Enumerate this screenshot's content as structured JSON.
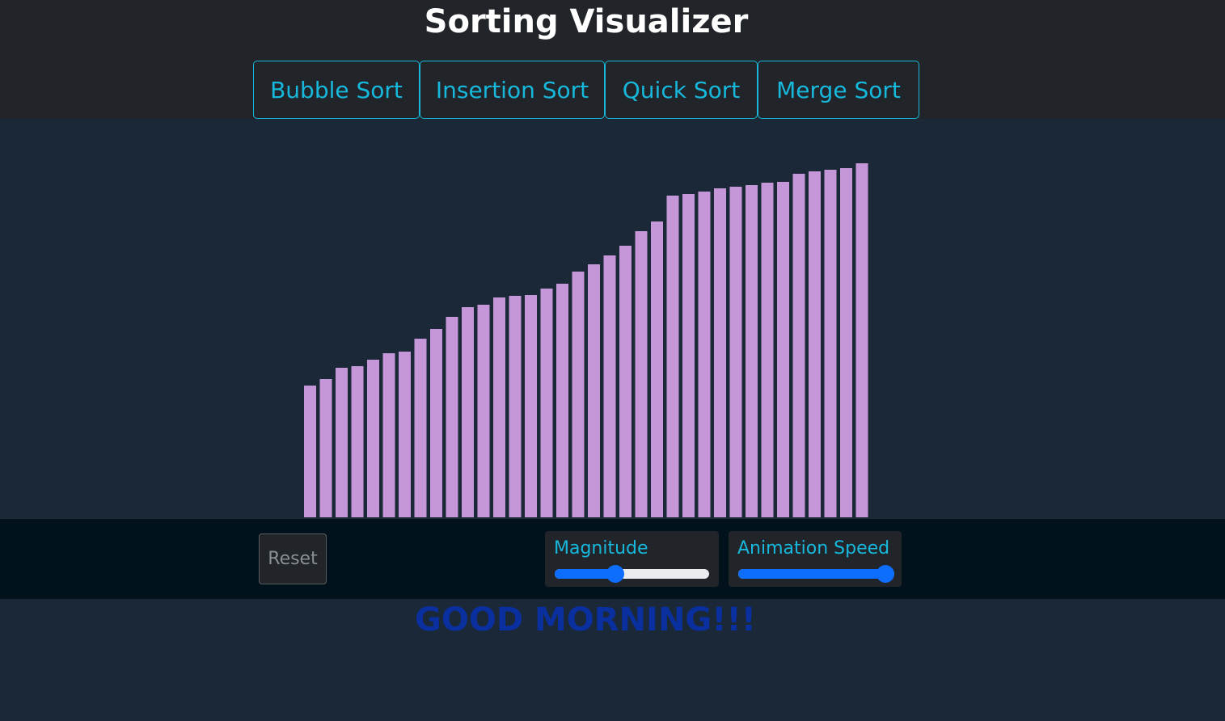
{
  "app": {
    "title": "Sorting Visualizer"
  },
  "algorithms": [
    {
      "label": "Bubble Sort"
    },
    {
      "label": "Insertion Sort"
    },
    {
      "label": "Quick Sort"
    },
    {
      "label": "Merge Sort"
    }
  ],
  "chart_data": {
    "type": "bar",
    "bar_color": "#c597d9",
    "values": [
      163,
      171,
      185,
      187,
      195,
      203,
      205,
      221,
      233,
      248,
      260,
      263,
      272,
      274,
      275,
      283,
      289,
      304,
      313,
      324,
      336,
      354,
      366,
      398,
      400,
      403,
      407,
      409,
      411,
      414,
      415,
      425,
      428,
      430,
      432,
      438
    ]
  },
  "controls": {
    "reset_label": "Reset",
    "magnitude": {
      "label": "Magnitude",
      "value": 0.38
    },
    "speed": {
      "label": "Animation Speed",
      "value": 1.0
    }
  },
  "greeting": "GOOD MORNING!!!",
  "colors": {
    "accent": "#17b8dc",
    "slider": "#0d6efd",
    "greeting": "#0a2f9e"
  }
}
